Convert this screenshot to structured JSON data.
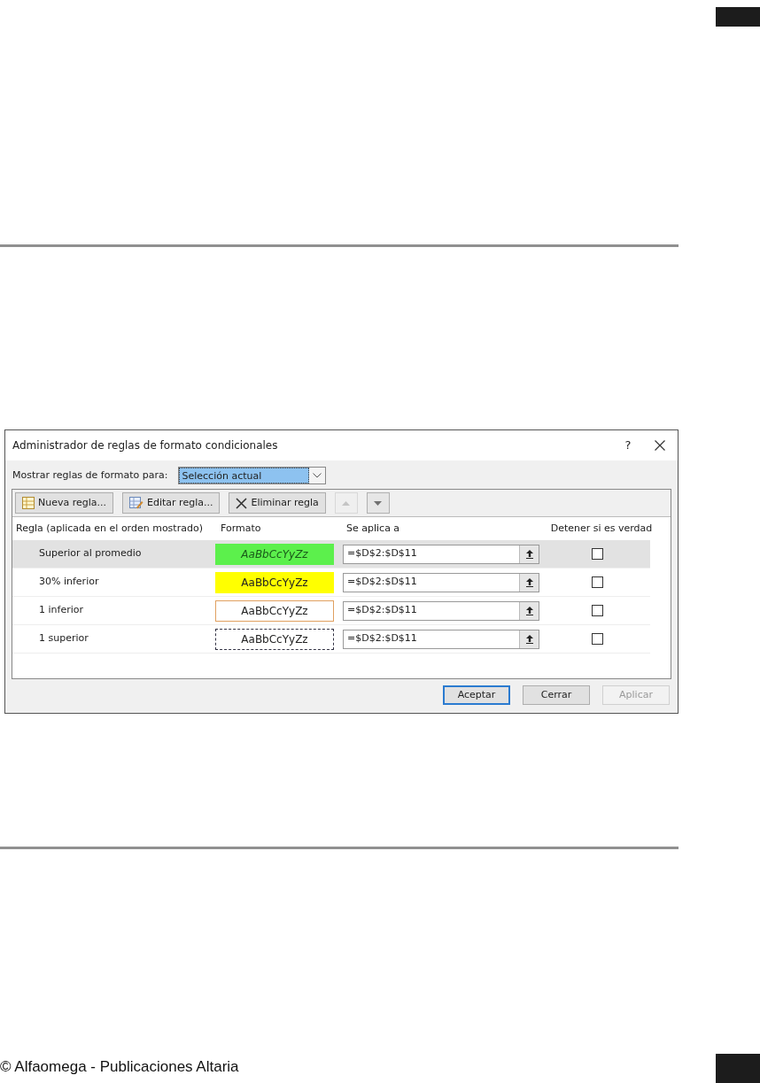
{
  "dialog": {
    "title": "Administrador de reglas de formato condicionales",
    "help": "?",
    "show_rules": {
      "label": "Mostrar reglas de formato para:",
      "value": "Selección actual"
    },
    "toolbar": [
      {
        "kind": "new",
        "label": "Nueva regla...",
        "disabled": false
      },
      {
        "kind": "edit",
        "label": "Editar regla...",
        "disabled": false
      },
      {
        "kind": "delete",
        "label": "Eliminar regla",
        "disabled": false
      },
      {
        "kind": "up",
        "disabled": true
      },
      {
        "kind": "down",
        "disabled": false
      }
    ],
    "columns": [
      "Regla (aplicada en el orden mostrado)",
      "Formato",
      "Se aplica a",
      "Detener si es verdad"
    ],
    "rules": [
      {
        "name": "Superior al promedio",
        "format": {
          "text": "AaBbCcYyZz",
          "color": "#5cf04c",
          "italic": true,
          "outlined": false,
          "dashed": false
        },
        "applies_to": "=$D$2:$D$11",
        "stop": false,
        "selected": true
      },
      {
        "name": "30% inferior",
        "format": {
          "text": "AaBbCcYyZz",
          "color": "#ffff00",
          "italic": false,
          "outlined": false,
          "dashed": false
        },
        "applies_to": "=$D$2:$D$11",
        "stop": false,
        "selected": false
      },
      {
        "name": "1 inferior",
        "format": {
          "text": "AaBbCcYyZz",
          "color": "#ffffff",
          "italic": false,
          "outlined": true,
          "dashed": false
        },
        "applies_to": "=$D$2:$D$11",
        "stop": false,
        "selected": false
      },
      {
        "name": "1 superior",
        "format": {
          "text": "AaBbCcYyZz",
          "color": "#ffffff",
          "italic": false,
          "outlined": false,
          "dashed": true
        },
        "applies_to": "=$D$2:$D$11",
        "stop": false,
        "selected": false
      }
    ],
    "buttons": [
      {
        "label": "Aceptar",
        "default": true,
        "disabled": false
      },
      {
        "label": "Cerrar",
        "default": false,
        "disabled": false
      },
      {
        "label": "Aplicar",
        "default": false,
        "disabled": true
      }
    ]
  },
  "footer": {
    "text": "© Alfaomega - Publicaciones Altaria"
  }
}
